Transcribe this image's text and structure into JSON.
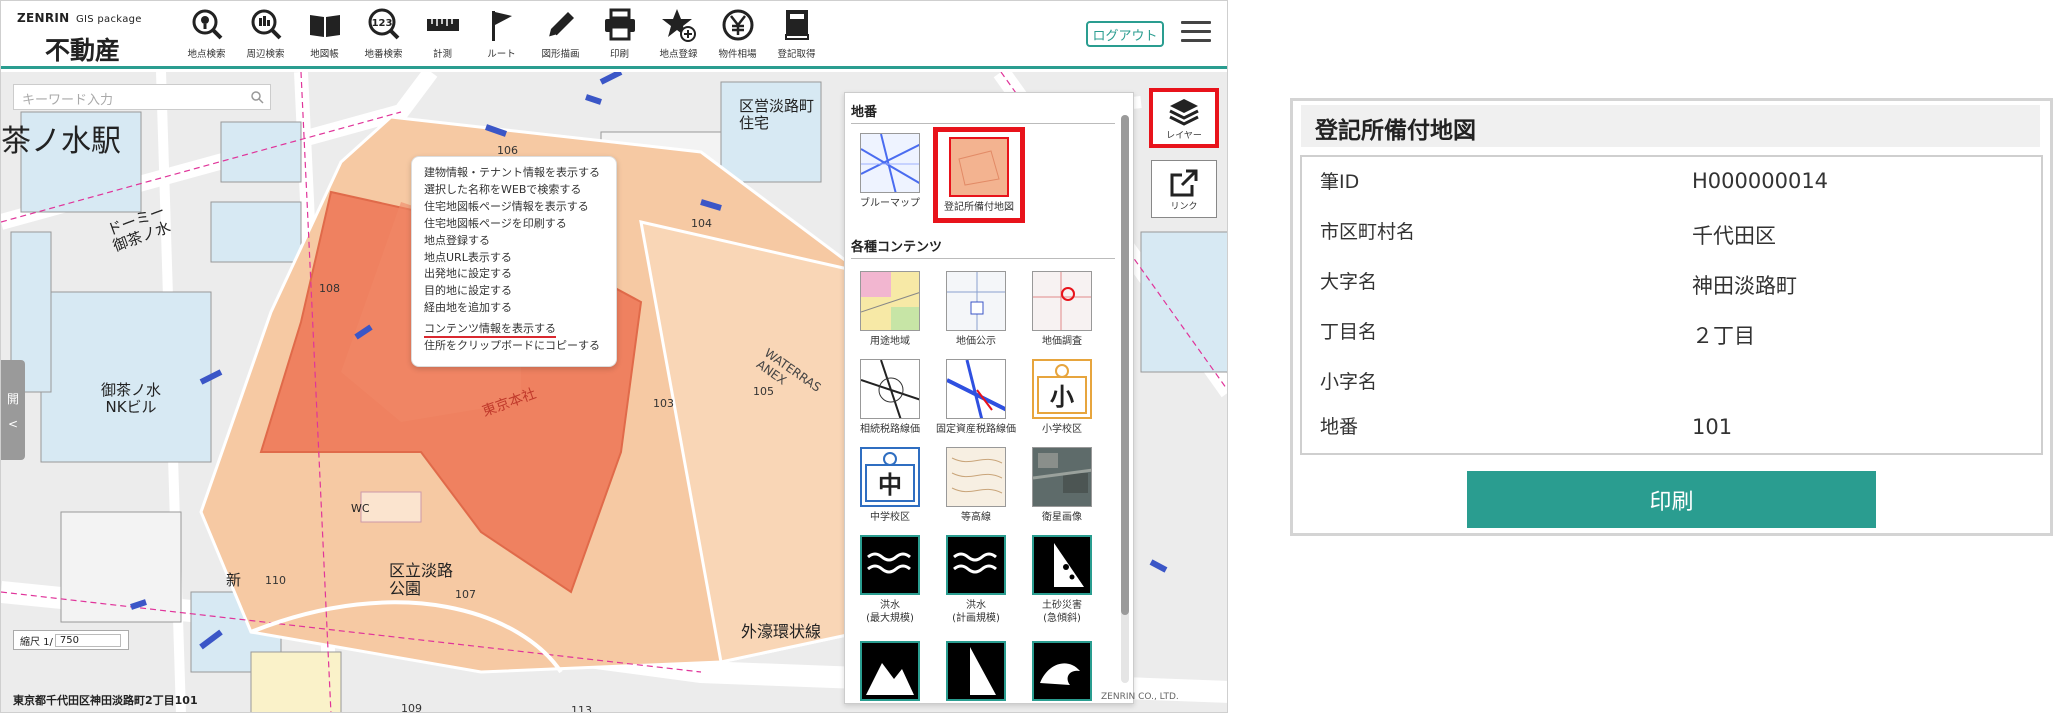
{
  "app": {
    "brand": "ZENRIN",
    "brand_sub": "GIS package",
    "title": "不動産",
    "logout_label": "ログアウト"
  },
  "toolbar": [
    {
      "label": "地点検索",
      "icon": "location-search-icon"
    },
    {
      "label": "周辺検索",
      "icon": "nearby-search-icon"
    },
    {
      "label": "地図帳",
      "icon": "map-book-icon"
    },
    {
      "label": "地番検索",
      "icon": "lot-number-search-icon"
    },
    {
      "label": "計測",
      "icon": "ruler-icon"
    },
    {
      "label": "ルート",
      "icon": "flag-icon"
    },
    {
      "label": "図形描画",
      "icon": "pencil-icon"
    },
    {
      "label": "印刷",
      "icon": "printer-icon"
    },
    {
      "label": "地点登録",
      "icon": "star-plus-icon"
    },
    {
      "label": "物件相場",
      "icon": "yen-icon"
    },
    {
      "label": "登記取得",
      "icon": "book-icon"
    }
  ],
  "search": {
    "placeholder": "キーワード入力"
  },
  "side_tab": {
    "label": "開"
  },
  "map_labels": {
    "station": "茶ノ水駅",
    "gaikan": "外濠環状線",
    "kuritsu_park": "区立淡路\n公園",
    "kuei_housing": "区営淡路町\n住宅",
    "ochanomizu_nk": "御茶ノ水\nNKビル",
    "dormy": "ドーミー\n御茶ノ水",
    "tokyo_honsha": "東京本社",
    "waterras": "WATERRAS\nANEX",
    "kanda": "神田淡路町",
    "wc": "WC",
    "shin": "新"
  },
  "lot_numbers": [
    "106",
    "104",
    "108",
    "103",
    "105",
    "107",
    "110",
    "113",
    "109"
  ],
  "context_menu": {
    "items": [
      "建物情報・テナント情報を表示する",
      "選択した名称をWEBで検索する",
      "住宅地図帳ページ情報を表示する",
      "住宅地図帳ページを印刷する",
      "地点登録する",
      "地点URL表示する",
      "出発地に設定する",
      "目的地に設定する",
      "経由地を追加する",
      "コンテンツ情報を表示する",
      "住所をクリップボードにコピーする"
    ],
    "highlighted_index": 9
  },
  "layer_panel": {
    "section1": "地番",
    "section1_items": [
      {
        "label": "ブルーマップ",
        "icon": "blue-map-thumb"
      },
      {
        "label": "登記所備付地図",
        "icon": "registry-map-thumb",
        "selected": true
      }
    ],
    "section2": "各種コンテンツ",
    "section2_items": [
      {
        "label": "用途地域",
        "icon": "zoning-thumb"
      },
      {
        "label": "地価公示",
        "icon": "land-price-thumb"
      },
      {
        "label": "地価調査",
        "icon": "land-survey-thumb"
      },
      {
        "label": "相続税路線価",
        "icon": "inheritance-route-thumb"
      },
      {
        "label": "固定資産税路線価",
        "icon": "property-tax-route-thumb"
      },
      {
        "label": "小学校区",
        "icon": "elementary-school-thumb"
      },
      {
        "label": "中学校区",
        "icon": "junior-high-thumb"
      },
      {
        "label": "等高線",
        "icon": "contour-thumb"
      },
      {
        "label": "衛星画像",
        "icon": "satellite-thumb"
      },
      {
        "label": "洪水\n(最大規模)",
        "icon": "flood-max-thumb"
      },
      {
        "label": "洪水\n(計画規模)",
        "icon": "flood-plan-thumb"
      },
      {
        "label": "土砂災害\n(急傾斜)",
        "icon": "landslide-thumb"
      }
    ],
    "school_char_sho": "小",
    "school_char_chu": "中"
  },
  "layer_button": {
    "label": "レイヤー"
  },
  "link_button": {
    "label": "リンク"
  },
  "scale": {
    "label": "縮尺 1/",
    "value": "750"
  },
  "address": "東京都千代田区神田淡路町2丁目101",
  "copyright": "ZENRIN CO., LTD.",
  "info": {
    "title": "登記所備付地図",
    "rows": [
      {
        "key": "筆ID",
        "value": "H000000014"
      },
      {
        "key": "市区町村名",
        "value": "千代田区"
      },
      {
        "key": "大字名",
        "value": "神田淡路町"
      },
      {
        "key": "丁目名",
        "value": "２丁目"
      },
      {
        "key": "小字名",
        "value": ""
      },
      {
        "key": "地番",
        "value": "101"
      }
    ],
    "print_label": "印刷"
  },
  "colors": {
    "accent": "#2a9d90",
    "highlight_red": "#e8131b",
    "parcel_orange": "#f6c9a3",
    "parcel_selected": "#ef8160"
  }
}
